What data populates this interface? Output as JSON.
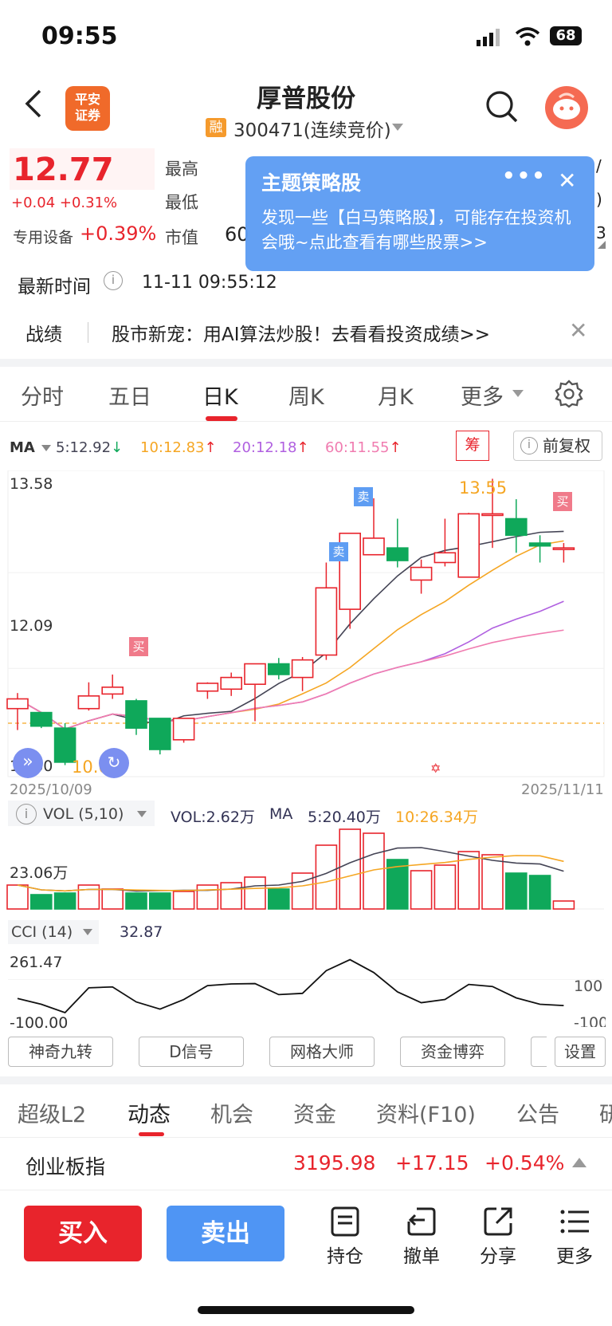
{
  "status": {
    "time": "09:55",
    "battery": "68"
  },
  "header": {
    "logo_text": "平安证券",
    "stock_name": "厚普股份",
    "rong_badge": "融",
    "stock_code": "300471(连续竞价)"
  },
  "quote": {
    "price": "12.77",
    "change": "+0.04 +0.31%",
    "sector_label": "专用设备",
    "sector_change": "+0.39%",
    "high_label": "最高",
    "low_label": "最低",
    "cap_label": "市值",
    "cap_value_partial": "60"
  },
  "popup": {
    "title": "主题策略股",
    "dots": "•••",
    "close": "✕",
    "text": "发现一些【白马策略股】，可能存在投资机会哦~点此查看有哪些股票>>"
  },
  "update": {
    "label": "最新时间",
    "value": "11-11 09:55:12"
  },
  "zhanji": {
    "label": "战绩",
    "text": "股市新宠：用AI算法炒股！去看看投资成绩>>"
  },
  "period_tabs": [
    "分时",
    "五日",
    "日K",
    "周K",
    "月K",
    "更多"
  ],
  "active_period": "日K",
  "ma": {
    "label": "MA",
    "ma5": "5:12.92",
    "ma10": "10:12.83",
    "ma20": "20:12.18",
    "ma60": "60:11.55",
    "chou": "筹",
    "fuquan": "前复权"
  },
  "colors": {
    "up": "#e8242c",
    "down": "#0fa85a",
    "ma5": "#444455",
    "ma10": "#f5a623",
    "ma20": "#b060e0",
    "ma60": "#f07cb0",
    "accent": "#4f95f4"
  },
  "kchart": {
    "y_top": "13.58",
    "y_mid": "12.09",
    "y_bottom": "10.60",
    "high_mark": "13.55",
    "low_mark": "10.63",
    "date_start": "2025/10/09",
    "date_end": "2025/11/11",
    "sell_tag": "卖",
    "buy_tag": "买"
  },
  "volume": {
    "label": "VOL (5,10)",
    "vol": "VOL:2.62万",
    "ma_label": "MA",
    "ma5": "5:20.40万",
    "ma10": "10:26.34万",
    "axis": "23.06万"
  },
  "cci": {
    "label": "CCI (14)",
    "value": "32.87",
    "axis_top": "261.47",
    "axis_bottom": "-100.00",
    "ref_100": "100",
    "ref_neg": "-100"
  },
  "tools": [
    "神奇九转",
    "D信号",
    "网格大师",
    "资金博弈",
    "设置"
  ],
  "bottom_tabs": [
    "超级L2",
    "动态",
    "机会",
    "资金",
    "资料(F10)",
    "公告",
    "研"
  ],
  "active_bottom_tab": "动态",
  "index": {
    "name": "创业板指",
    "value": "3195.98",
    "change": "+17.15",
    "pct": "+0.54%"
  },
  "actions": {
    "buy": "买入",
    "sell": "卖出",
    "position": "持仓",
    "cancel": "撤单",
    "share": "分享",
    "more": "更多"
  },
  "chart_data": {
    "type": "candlestick",
    "ylim": [
      10.6,
      13.58
    ],
    "ohlc": [
      [
        11.2,
        11.3,
        10.98,
        11.36
      ],
      [
        11.16,
        11.02,
        11.0,
        11.16
      ],
      [
        11.0,
        10.65,
        10.62,
        11.05
      ],
      [
        11.2,
        11.33,
        11.18,
        11.47
      ],
      [
        11.35,
        11.42,
        11.3,
        11.55
      ],
      [
        11.28,
        11.0,
        10.93,
        11.3
      ],
      [
        11.1,
        10.78,
        10.73,
        11.1
      ],
      [
        10.88,
        11.1,
        10.85,
        11.1
      ],
      [
        11.38,
        11.46,
        11.3,
        11.47
      ],
      [
        11.4,
        11.52,
        11.33,
        11.57
      ],
      [
        11.45,
        11.66,
        11.07,
        11.66
      ],
      [
        11.66,
        11.55,
        11.5,
        11.72
      ],
      [
        11.52,
        11.7,
        11.38,
        11.73
      ],
      [
        11.75,
        12.44,
        11.7,
        12.7
      ],
      [
        12.22,
        13.0,
        12.02,
        13.0
      ],
      [
        12.78,
        12.95,
        12.84,
        13.36
      ],
      [
        12.85,
        12.72,
        12.65,
        13.15
      ],
      [
        12.52,
        12.65,
        12.38,
        12.73
      ],
      [
        12.7,
        12.8,
        12.66,
        13.15
      ],
      [
        12.55,
        13.2,
        12.55,
        13.21
      ],
      [
        13.2,
        13.2,
        12.85,
        13.56
      ],
      [
        13.15,
        12.98,
        12.8,
        13.35
      ],
      [
        12.9,
        12.87,
        12.7,
        12.98
      ],
      [
        12.85,
        12.85,
        12.7,
        12.9
      ]
    ],
    "volume_ratio": [
      0.3,
      0.18,
      0.2,
      0.3,
      0.25,
      0.2,
      0.2,
      0.22,
      0.3,
      0.33,
      0.4,
      0.25,
      0.45,
      0.8,
      1.0,
      0.95,
      0.62,
      0.48,
      0.55,
      0.72,
      0.68,
      0.45,
      0.42,
      0.1
    ]
  }
}
